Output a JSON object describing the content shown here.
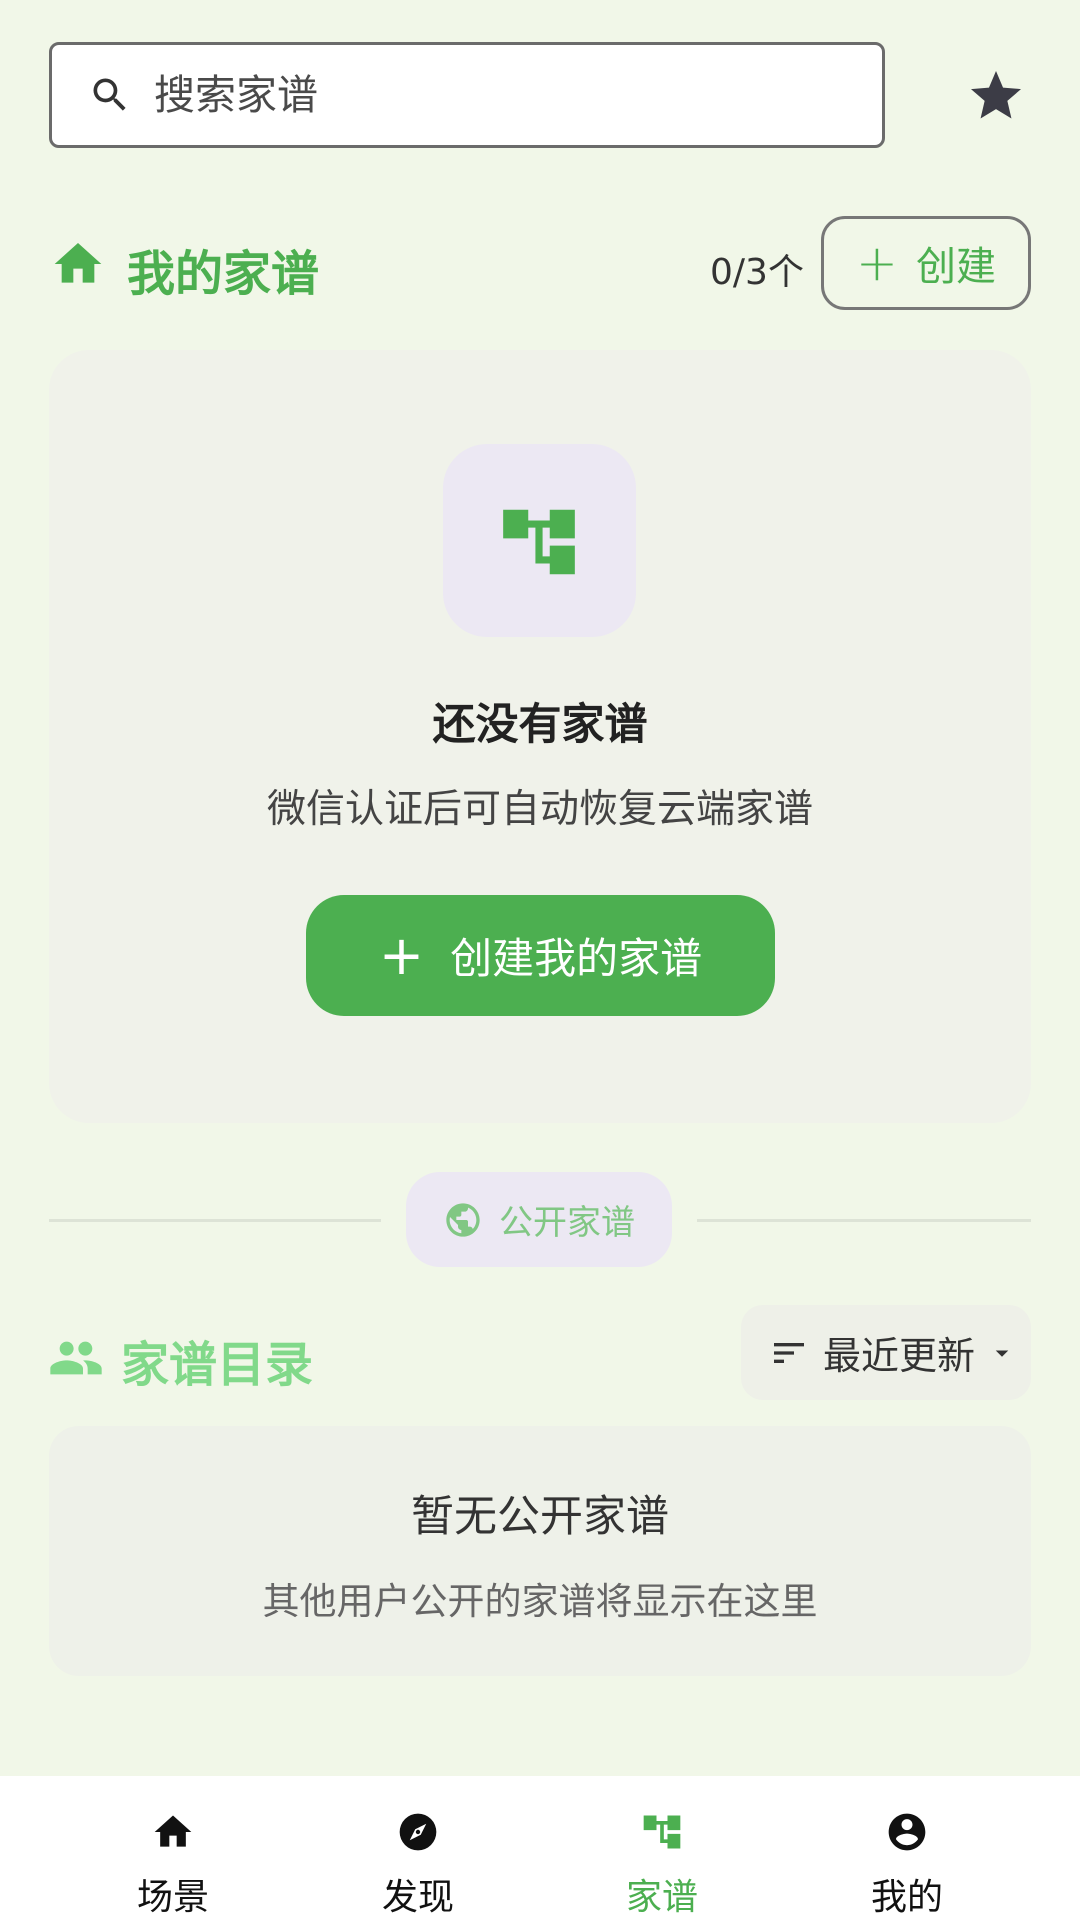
{
  "search": {
    "placeholder": "搜索家谱",
    "value": ""
  },
  "header": {
    "favorites_icon": "star-icon"
  },
  "my_trees": {
    "title": "我的家谱",
    "count": "0/3个",
    "create_label": "创建",
    "create_plus": "+"
  },
  "empty_state": {
    "title": "还没有家谱",
    "subtitle": "微信认证后可自动恢复云端家谱",
    "button_plus": "+",
    "button_label": "创建我的家谱"
  },
  "public_divider": {
    "label": "公开家谱",
    "icon": "globe-icon"
  },
  "directory": {
    "title": "家谱目录",
    "sort_label": "最近更新",
    "empty_title": "暂无公开家谱",
    "empty_subtitle": "其他用户公开的家谱将显示在这里"
  },
  "bottom_nav": {
    "items": [
      {
        "label": "场景",
        "icon": "home-icon",
        "active": false
      },
      {
        "label": "发现",
        "icon": "compass-icon",
        "active": false
      },
      {
        "label": "家谱",
        "icon": "family-tree-icon",
        "active": true
      },
      {
        "label": "我的",
        "icon": "account-circle-icon",
        "active": false
      }
    ]
  },
  "colors": {
    "background": "#f1f7e8",
    "accent": "#4caf50",
    "accent_light": "#81d98a",
    "chip_bg": "#ece8f3"
  }
}
